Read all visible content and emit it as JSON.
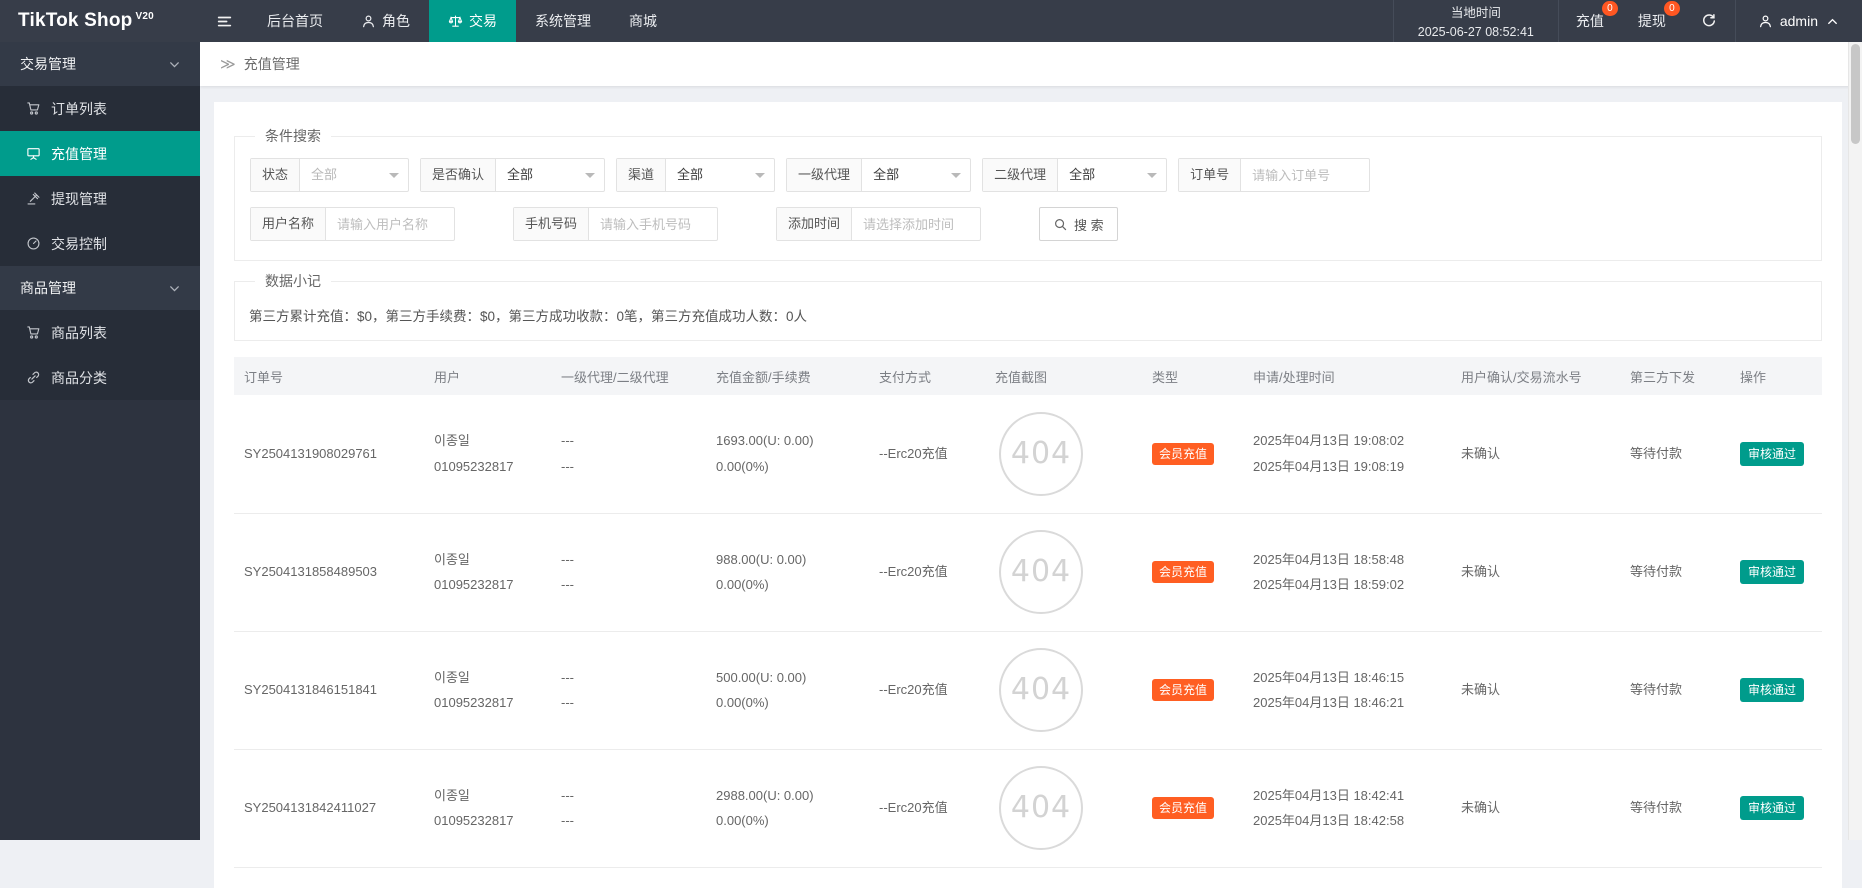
{
  "colors": {
    "accent_teal": "#009c8c",
    "type_badge_orange": "#ff5e22",
    "notification_orange": "#ff5722",
    "header_bg": "#373d49",
    "sidebar_bg": "#2d333f"
  },
  "header": {
    "logo": "TikTok Shop",
    "logo_sup": "V20",
    "nav": [
      {
        "key": "dashboard",
        "label": "后台首页"
      },
      {
        "key": "role",
        "label": "角色",
        "icon": "user-icon"
      },
      {
        "key": "trade",
        "label": "交易",
        "icon": "scales-icon",
        "active": true
      },
      {
        "key": "system",
        "label": "系统管理"
      },
      {
        "key": "mall",
        "label": "商城"
      }
    ],
    "local_time_label": "当地时间",
    "local_time_value": "2025-06-27 08:52:41",
    "recharge_label": "充值",
    "recharge_badge": "0",
    "withdraw_label": "提现",
    "withdraw_badge": "0",
    "username": "admin"
  },
  "sidebar": {
    "groups": [
      {
        "key": "trade-management",
        "label": "交易管理",
        "items": [
          {
            "key": "order-list",
            "label": "订单列表",
            "icon": "cart-icon"
          },
          {
            "key": "recharge-management",
            "label": "充值管理",
            "icon": "board-icon",
            "active": true
          },
          {
            "key": "withdraw-management",
            "label": "提现管理",
            "icon": "gavel-icon"
          },
          {
            "key": "trade-control",
            "label": "交易控制",
            "icon": "gauge-icon"
          }
        ]
      },
      {
        "key": "product-management",
        "label": "商品管理",
        "items": [
          {
            "key": "product-list",
            "label": "商品列表",
            "icon": "cart-icon"
          },
          {
            "key": "product-category",
            "label": "商品分类",
            "icon": "link-icon"
          }
        ]
      }
    ]
  },
  "breadcrumb": {
    "label": "充值管理"
  },
  "filters": {
    "legend": "条件搜索",
    "selects": [
      {
        "key": "status",
        "label": "状态",
        "value": "全部",
        "muted": true
      },
      {
        "key": "confirmed",
        "label": "是否确认",
        "value": "全部"
      },
      {
        "key": "channel",
        "label": "渠道",
        "value": "全部"
      },
      {
        "key": "agent1",
        "label": "一级代理",
        "value": "全部"
      },
      {
        "key": "agent2",
        "label": "二级代理",
        "value": "全部"
      }
    ],
    "order_no": {
      "label": "订单号",
      "placeholder": "请输入订单号"
    },
    "username": {
      "label": "用户名称",
      "placeholder": "请输入用户名称"
    },
    "phone": {
      "label": "手机号码",
      "placeholder": "请输入手机号码"
    },
    "add_time": {
      "label": "添加时间",
      "placeholder": "请选择添加时间"
    },
    "search_label": "搜 索"
  },
  "summary": {
    "legend": "数据小记",
    "text": "第三方累计充值：$0，第三方手续费：$0，第三方成功收款：0笔，第三方充值成功人数：0人"
  },
  "table": {
    "headers": [
      "订单号",
      "用户",
      "一级代理/二级代理",
      "充值金额/手续费",
      "支付方式",
      "充值截图",
      "类型",
      "申请/处理时间",
      "用户确认/交易流水号",
      "第三方下发",
      "操作"
    ],
    "rows": [
      {
        "order_no": "SY2504131908029761",
        "user": [
          "이종일",
          "01095232817"
        ],
        "agents": [
          "---",
          "---"
        ],
        "amount": [
          "1693.00(U: 0.00)",
          "0.00(0%)"
        ],
        "pay_method": "--Erc20充值",
        "screenshot": "404",
        "type": "会员充值",
        "times": [
          "2025年04月13日 19:08:02",
          "2025年04月13日 19:08:19"
        ],
        "confirm": "未确认",
        "third_party": "等待付款",
        "action": "审核通过"
      },
      {
        "order_no": "SY2504131858489503",
        "user": [
          "이종일",
          "01095232817"
        ],
        "agents": [
          "---",
          "---"
        ],
        "amount": [
          "988.00(U: 0.00)",
          "0.00(0%)"
        ],
        "pay_method": "--Erc20充值",
        "screenshot": "404",
        "type": "会员充值",
        "times": [
          "2025年04月13日 18:58:48",
          "2025年04月13日 18:59:02"
        ],
        "confirm": "未确认",
        "third_party": "等待付款",
        "action": "审核通过"
      },
      {
        "order_no": "SY2504131846151841",
        "user": [
          "이종일",
          "01095232817"
        ],
        "agents": [
          "---",
          "---"
        ],
        "amount": [
          "500.00(U: 0.00)",
          "0.00(0%)"
        ],
        "pay_method": "--Erc20充值",
        "screenshot": "404",
        "type": "会员充值",
        "times": [
          "2025年04月13日 18:46:15",
          "2025年04月13日 18:46:21"
        ],
        "confirm": "未确认",
        "third_party": "等待付款",
        "action": "审核通过"
      },
      {
        "order_no": "SY2504131842411027",
        "user": [
          "이종일",
          "01095232817"
        ],
        "agents": [
          "---",
          "---"
        ],
        "amount": [
          "2988.00(U: 0.00)",
          "0.00(0%)"
        ],
        "pay_method": "--Erc20充值",
        "screenshot": "404",
        "type": "会员充值",
        "times": [
          "2025年04月13日 18:42:41",
          "2025年04月13日 18:42:58"
        ],
        "confirm": "未确认",
        "third_party": "等待付款",
        "action": "审核通过"
      }
    ]
  }
}
